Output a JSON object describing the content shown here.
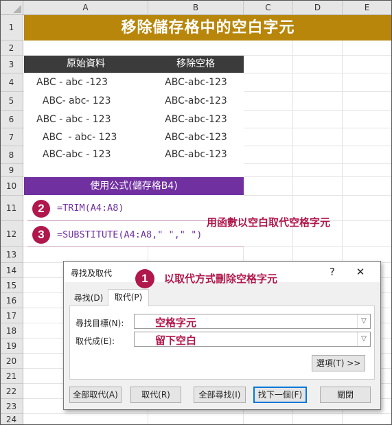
{
  "columns": [
    "A",
    "B",
    "C",
    "D",
    "E"
  ],
  "rows": [
    "1",
    "2",
    "3",
    "4",
    "5",
    "6",
    "7",
    "8",
    "9",
    "10",
    "11",
    "12",
    "13",
    "14",
    "15",
    "16",
    "17",
    "18",
    "19",
    "20",
    "21",
    "22",
    "23",
    "24"
  ],
  "sheet": {
    "title": "移除儲存格中的空白字元",
    "header": {
      "col_a": "原始資料",
      "col_b": "移除空格"
    },
    "data": [
      {
        "original": "ABC - abc -123",
        "cleaned": "ABC-abc-123"
      },
      {
        "original": "  ABC- abc- 123",
        "cleaned": "ABC-abc-123"
      },
      {
        "original": "ABC - abc - 123",
        "cleaned": "ABC-abc-123"
      },
      {
        "original": "  ABC  - abc- 123",
        "cleaned": "ABC-abc-123"
      },
      {
        "original": "  ABC-abc - 123",
        "cleaned": "ABC-abc-123"
      }
    ],
    "formula_header": "使用公式(儲存格B4)",
    "formula_1": "=TRIM(A4:A8)",
    "formula_2": "=SUBSTITUTE(A4:A8,\" \",\" \")"
  },
  "annotations": {
    "badge_1": "1",
    "badge_2": "2",
    "badge_3": "3",
    "note_3": "用函數以空白取代空格字元",
    "note_1": "以取代方式刪除空格字元"
  },
  "dialog": {
    "title": "尋找及取代",
    "help": "?",
    "close": "✕",
    "tab_find": "尋找(D)",
    "tab_replace": "取代(P)",
    "find_label": "尋找目標(N):",
    "find_value": "空格字元",
    "replace_label": "取代成(E):",
    "replace_value": "留下空白",
    "options_button": "選項(T) >>",
    "buttons": {
      "replace_all": "全部取代(A)",
      "replace": "取代(R)",
      "find_all": "全部尋找(I)",
      "find_next": "找下一個(F)",
      "close": "關閉"
    }
  },
  "colors": {
    "title_bg": "#b8860b",
    "header_bg": "#3b3b3b",
    "formula_bar": "#7030a0",
    "accent": "#b0174a"
  }
}
